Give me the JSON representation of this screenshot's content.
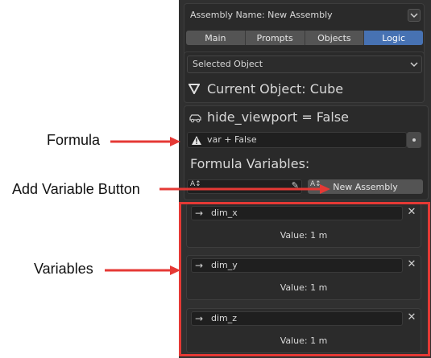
{
  "assembly": {
    "name_label": "Assembly Name: New Assembly"
  },
  "tabs": [
    {
      "label": "Main",
      "active": false
    },
    {
      "label": "Prompts",
      "active": false
    },
    {
      "label": "Objects",
      "active": false
    },
    {
      "label": "Logic",
      "active": true
    }
  ],
  "selected_object": {
    "dropdown_label": "Selected Object",
    "current_label": "Current Object: Cube"
  },
  "driver": {
    "property_label": "hide_viewport = False",
    "formula": "var + False",
    "formula_variables_label": "Formula Variables:",
    "new_assembly_label": "New Assembly"
  },
  "variables": [
    {
      "name": "dim_x",
      "value_label": "Value: 1 m"
    },
    {
      "name": "dim_y",
      "value_label": "Value: 1 m"
    },
    {
      "name": "dim_z",
      "value_label": "Value: 1 m"
    }
  ],
  "annotations": {
    "formula": "Formula",
    "add_variable": "Add Variable Button",
    "variables": "Variables"
  },
  "colors": {
    "panel_bg": "#303030",
    "tab_active": "#4772b3",
    "annotation_arrow": "#e53935"
  },
  "icons": {
    "close": "✕",
    "arrow": "→"
  }
}
